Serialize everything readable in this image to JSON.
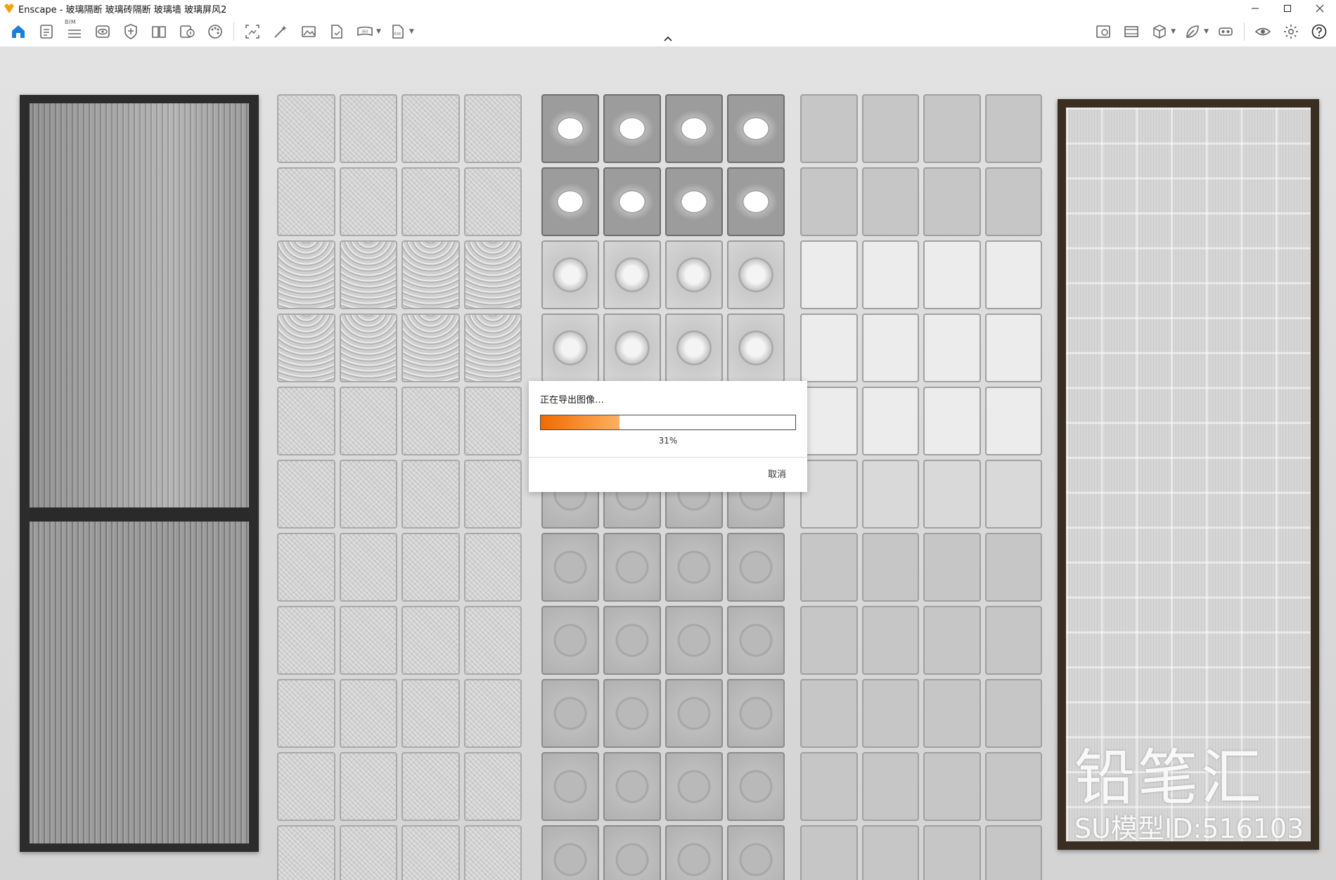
{
  "window": {
    "title": "Enscape - 玻璃隔断 玻璃砖隔断 玻璃墙 玻璃屏风2",
    "app_icon": "enscape-logo-icon",
    "controls": [
      "minimize",
      "maximize",
      "close"
    ]
  },
  "toolbar": {
    "bim_label": "BIM",
    "left_icons": [
      "home-icon",
      "document-icon",
      "bim-list-icon",
      "eye-render-icon",
      "shield-icon",
      "book-icon",
      "info-sheet-icon",
      "material-palette-icon",
      "screenshot-icon",
      "magic-wand-icon",
      "image-icon",
      "document-check-icon",
      "panorama-icon",
      "exe-export-icon"
    ],
    "right_icons": [
      "image-settings-icon",
      "film-icon",
      "cube-icon",
      "leaf-icon",
      "vr-headset-icon",
      "eye-icon",
      "settings-gear-icon",
      "help-icon"
    ]
  },
  "scene": {
    "watermark_brand": "铅笔汇",
    "watermark_id": "SU模型ID:516103"
  },
  "dialog": {
    "title": "正在导出图像…",
    "progress": 0.31,
    "progress_label": "31%",
    "cancel_label": "取消",
    "progress_color": "#f26a00"
  }
}
